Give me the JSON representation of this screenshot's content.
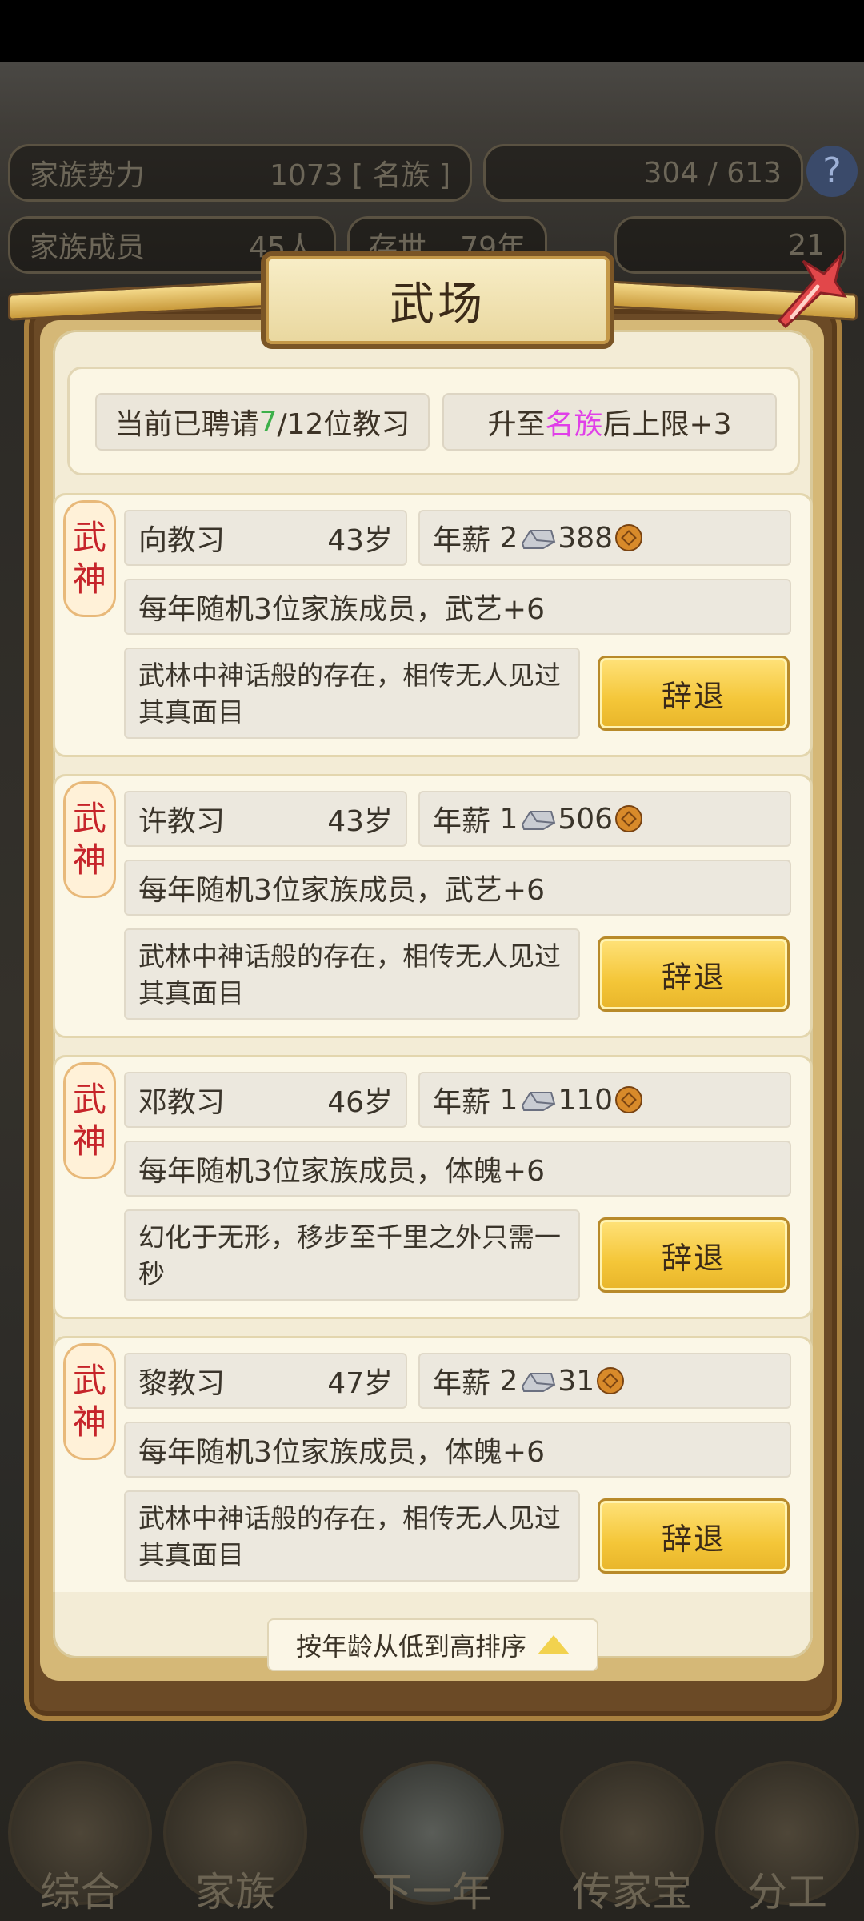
{
  "background": {
    "family_power_label": "家族势力",
    "family_power_value": "1073 [ 名族 ]",
    "currency": "304 / 613",
    "family_members_label": "家族成员",
    "family_members_value": "45人",
    "existence_label": "存世",
    "existence_value": "79年",
    "gold_value": "21"
  },
  "modal": {
    "title": "武场",
    "hired_prefix": "当前已聘请",
    "hired_count": "7",
    "hired_suffix": "/12位教习",
    "upgrade_prefix": "升至",
    "upgrade_highlight": "名族",
    "upgrade_suffix": "后上限+3",
    "sort_label": "按年龄从低到高排序",
    "instructors": [
      {
        "rank_line1": "武",
        "rank_line2": "神",
        "name": "向教习",
        "age": "43岁",
        "salary_label": "年薪",
        "silver": "2",
        "copper": "388",
        "effect": "每年随机3位家族成员，武艺+6",
        "description": "武林中神话般的存在，相传无人见过其真面目",
        "dismiss_label": "辞退"
      },
      {
        "rank_line1": "武",
        "rank_line2": "神",
        "name": "许教习",
        "age": "43岁",
        "salary_label": "年薪",
        "silver": "1",
        "copper": "506",
        "effect": "每年随机3位家族成员，武艺+6",
        "description": "武林中神话般的存在，相传无人见过其真面目",
        "dismiss_label": "辞退"
      },
      {
        "rank_line1": "武",
        "rank_line2": "神",
        "name": "邓教习",
        "age": "46岁",
        "salary_label": "年薪",
        "silver": "1",
        "copper": "110",
        "effect": "每年随机3位家族成员，体魄+6",
        "description": "幻化于无形，移步至千里之外只需一秒",
        "dismiss_label": "辞退"
      },
      {
        "rank_line1": "武",
        "rank_line2": "神",
        "name": "黎教习",
        "age": "47岁",
        "salary_label": "年薪",
        "silver": "2",
        "copper": "31",
        "effect": "每年随机3位家族成员，体魄+6",
        "description": "武林中神话般的存在，相传无人见过其真面目",
        "dismiss_label": "辞退"
      }
    ]
  },
  "bottom_nav": [
    {
      "label": "综合"
    },
    {
      "label": "家族"
    },
    {
      "label": "下一年"
    },
    {
      "label": "传家宝"
    },
    {
      "label": "分工"
    }
  ],
  "colors": {
    "count_green": "#3db04a",
    "highlight_magenta": "#e040e8",
    "rank_red": "#c6242a",
    "button_gold": "#f4c638"
  }
}
